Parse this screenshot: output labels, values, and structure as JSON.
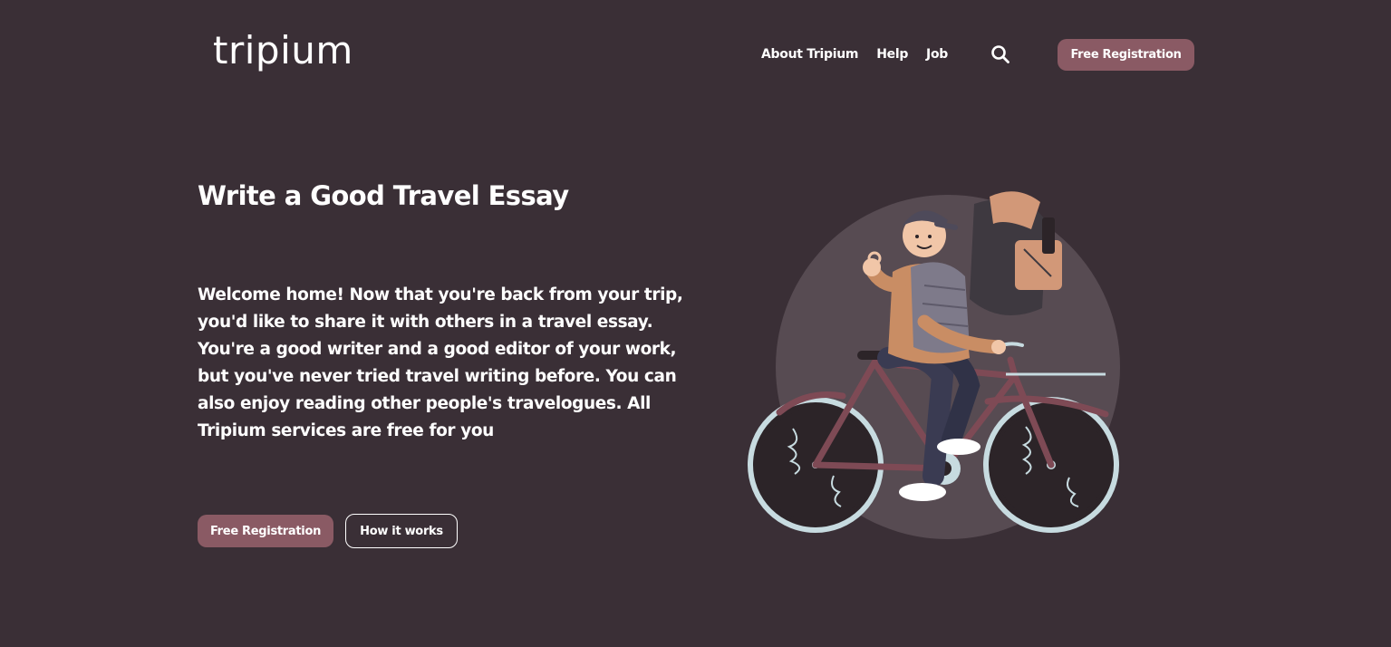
{
  "header": {
    "logo": "tripium",
    "nav": [
      {
        "label": "About Tripium"
      },
      {
        "label": "Help"
      },
      {
        "label": "Job"
      }
    ],
    "search_icon": "search-icon",
    "cta_label": "Free Registration"
  },
  "hero": {
    "title": "Write a Good Travel Essay",
    "description": "Welcome home! Now that you're back from your trip, you'd like to share it with others in a travel essay. You're a good writer and a good editor of your work, but you've never tried travel writing before. You can also enjoy reading other people's travelogues. All Tripium services are free for you",
    "primary_cta": "Free Registration",
    "secondary_cta": "How it works"
  },
  "illustration": {
    "subject": "cyclist-with-backpack-illustration"
  },
  "colors": {
    "background": "#3a2f36",
    "accent": "#8a5a64",
    "text": "#ffffff",
    "circle": "#574b52"
  }
}
